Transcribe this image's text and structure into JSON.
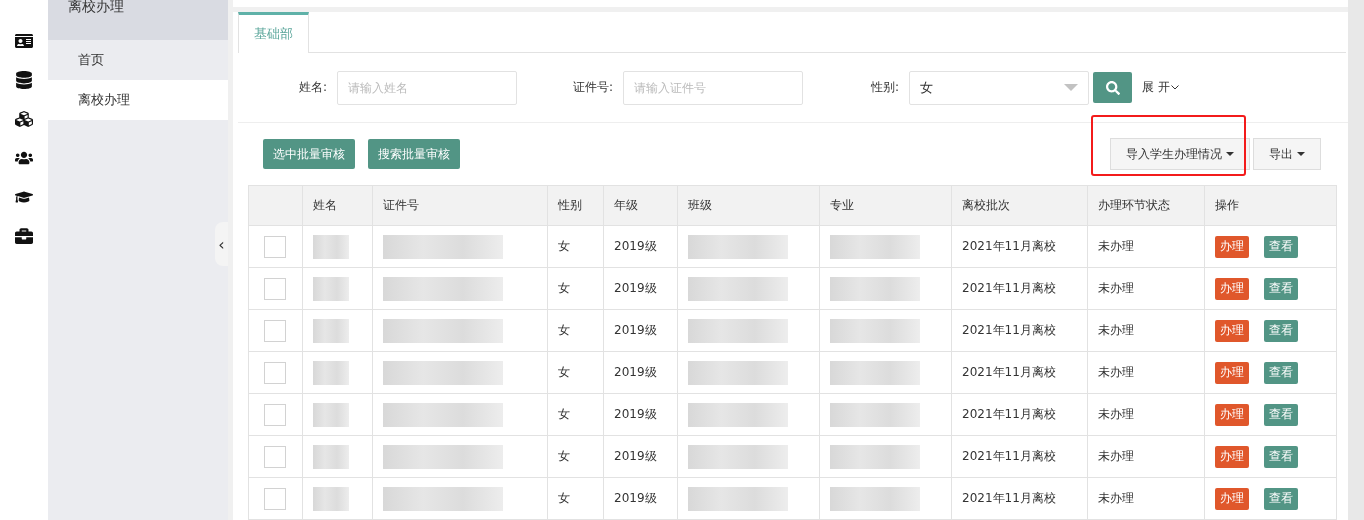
{
  "sidebar": {
    "title": "离校办理",
    "items": [
      {
        "label": "首页",
        "selected": false
      },
      {
        "label": "离校办理",
        "selected": true
      }
    ],
    "collapse": "‹"
  },
  "tabs": [
    {
      "label": "基础部",
      "selected": true
    }
  ],
  "filters": {
    "name": {
      "label": "姓名:",
      "placeholder": "请输入姓名"
    },
    "id": {
      "label": "证件号:",
      "placeholder": "请输入证件号"
    },
    "gender": {
      "label": "性别:",
      "value": "女"
    },
    "expand": "展 开"
  },
  "actions": {
    "left": [
      "选中批量审核",
      "搜索批量审核"
    ],
    "right": [
      {
        "label": "导入学生办理情况",
        "highlighted": true
      },
      {
        "label": "导出",
        "highlighted": false
      }
    ]
  },
  "table": {
    "columns": [
      "姓名",
      "证件号",
      "性别",
      "年级",
      "班级",
      "专业",
      "离校批次",
      "办理环节状态",
      "操作"
    ],
    "rows": [
      {
        "checked": false,
        "redacted": true,
        "gender": "女",
        "grade": "2019级",
        "batch": "2021年11月离校",
        "status": "未办理",
        "ops": [
          "办理",
          "查看"
        ]
      },
      {
        "checked": false,
        "redacted": true,
        "gender": "女",
        "grade": "2019级",
        "batch": "2021年11月离校",
        "status": "未办理",
        "ops": [
          "办理",
          "查看"
        ]
      },
      {
        "checked": false,
        "redacted": true,
        "gender": "女",
        "grade": "2019级",
        "batch": "2021年11月离校",
        "status": "未办理",
        "ops": [
          "办理",
          "查看"
        ]
      },
      {
        "checked": false,
        "redacted": true,
        "gender": "女",
        "grade": "2019级",
        "batch": "2021年11月离校",
        "status": "未办理",
        "ops": [
          "办理",
          "查看"
        ]
      },
      {
        "checked": false,
        "redacted": true,
        "gender": "女",
        "grade": "2019级",
        "batch": "2021年11月离校",
        "status": "未办理",
        "ops": [
          "办理",
          "查看"
        ]
      },
      {
        "checked": false,
        "redacted": true,
        "gender": "女",
        "grade": "2019级",
        "batch": "2021年11月离校",
        "status": "未办理",
        "ops": [
          "办理",
          "查看"
        ]
      },
      {
        "checked": false,
        "redacted": true,
        "gender": "女",
        "grade": "2019级",
        "batch": "2021年11月离校",
        "status": "未办理",
        "ops": [
          "办理",
          "查看"
        ]
      }
    ]
  }
}
